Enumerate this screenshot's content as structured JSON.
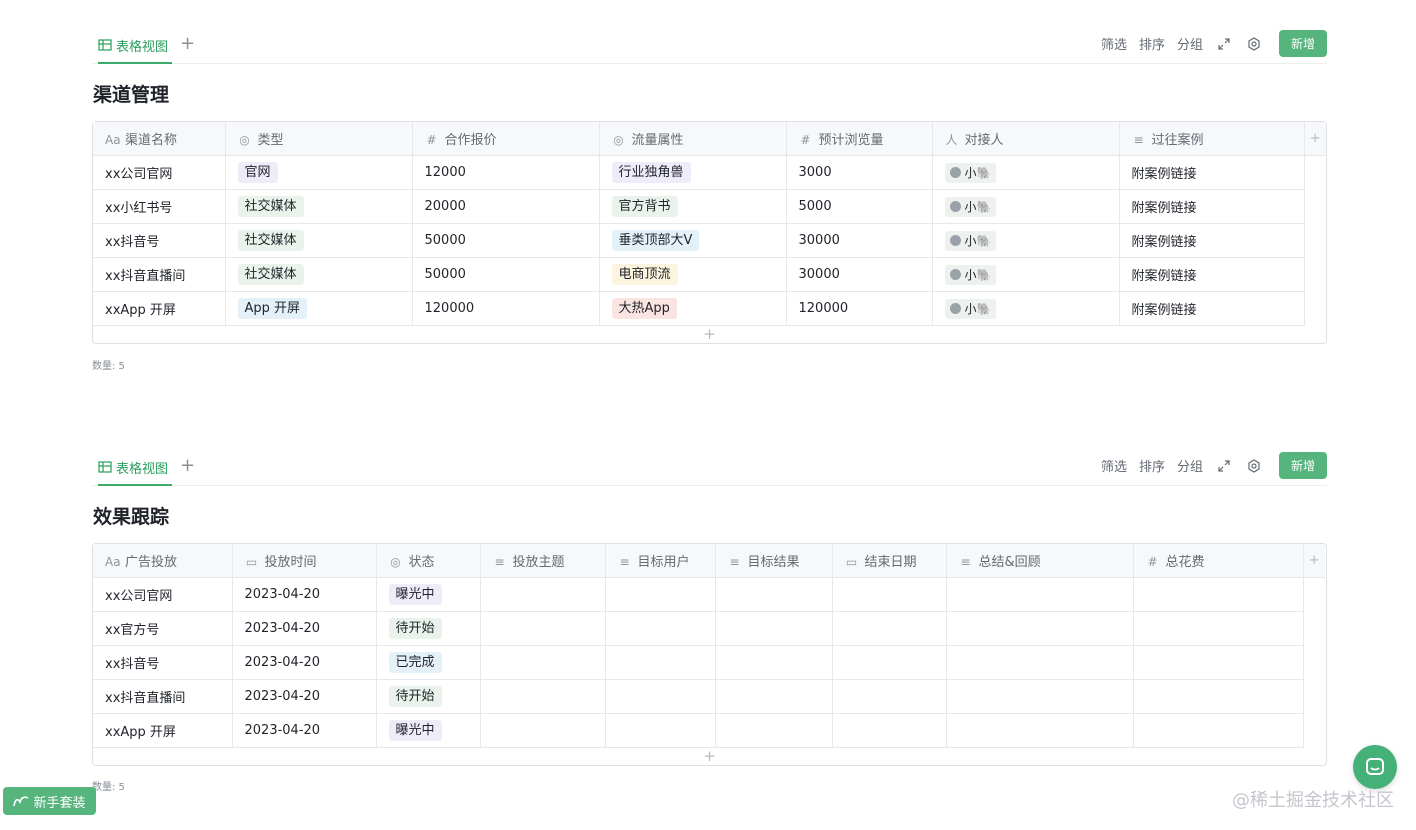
{
  "colors": {
    "accent": "#56b47d",
    "tab_active": "#2a9d5c"
  },
  "toolbar": {
    "tab_label": "表格视图",
    "add": "+",
    "filter": "筛选",
    "sort": "排序",
    "group": "分组",
    "new": "新增"
  },
  "table1": {
    "title": "渠道管理",
    "headers": [
      {
        "icon": "Aa",
        "label": "渠道名称"
      },
      {
        "icon": "◎",
        "label": "类型"
      },
      {
        "icon": "#",
        "label": "合作报价"
      },
      {
        "icon": "◎",
        "label": "流量属性"
      },
      {
        "icon": "#",
        "label": "预计浏览量"
      },
      {
        "icon": "人",
        "label": "对接人"
      },
      {
        "icon": "≡",
        "label": "过往案例"
      }
    ],
    "rows": [
      {
        "name": "xx公司官网",
        "type": "官网",
        "price": "12000",
        "traffic": "行业独角兽",
        "views": "3000",
        "contact": "小🐘",
        "case": "附案例链接"
      },
      {
        "name": "xx小红书号",
        "type": "社交媒体",
        "price": "20000",
        "traffic": "官方背书",
        "views": "5000",
        "contact": "小🐘",
        "case": "附案例链接"
      },
      {
        "name": "xx抖音号",
        "type": "社交媒体",
        "price": "50000",
        "traffic": "垂类顶部大V",
        "views": "30000",
        "contact": "小🐘",
        "case": "附案例链接"
      },
      {
        "name": "xx抖音直播间",
        "type": "社交媒体",
        "price": "50000",
        "traffic": "电商顶流",
        "views": "30000",
        "contact": "小🐘",
        "case": "附案例链接"
      },
      {
        "name": "xxApp 开屏",
        "type": "App 开屏",
        "price": "120000",
        "traffic": "大热App",
        "views": "120000",
        "contact": "小🐘",
        "case": "附案例链接"
      }
    ],
    "tag_colors": {
      "官网": "#eeecf9",
      "社交媒体": "#e9f3ec",
      "App 开屏": "#e5f1f9",
      "行业独角兽": "#eeecf9",
      "官方背书": "#e9f3ec",
      "垂类顶部大V": "#e5f1f9",
      "电商顶流": "#fbf4de",
      "大热App": "#fae4e2"
    },
    "count": "数量: 5"
  },
  "table2": {
    "title": "效果跟踪",
    "headers": [
      {
        "icon": "Aa",
        "label": "广告投放"
      },
      {
        "icon": "▭",
        "label": "投放时间"
      },
      {
        "icon": "◎",
        "label": "状态"
      },
      {
        "icon": "≡",
        "label": "投放主题"
      },
      {
        "icon": "≡",
        "label": "目标用户"
      },
      {
        "icon": "≡",
        "label": "目标结果"
      },
      {
        "icon": "▭",
        "label": "结束日期"
      },
      {
        "icon": "≡",
        "label": "总结&回顾"
      },
      {
        "icon": "#",
        "label": "总花费"
      }
    ],
    "rows": [
      {
        "name": "xx公司官网",
        "date": "2023-04-20",
        "status": "曝光中"
      },
      {
        "name": "xx官方号",
        "date": "2023-04-20",
        "status": "待开始"
      },
      {
        "name": "xx抖音号",
        "date": "2023-04-20",
        "status": "已完成"
      },
      {
        "name": "xx抖音直播间",
        "date": "2023-04-20",
        "status": "待开始"
      },
      {
        "name": "xxApp 开屏",
        "date": "2023-04-20",
        "status": "曝光中"
      }
    ],
    "status_colors": {
      "曝光中": "#eeecf9",
      "待开始": "#e9f3ec",
      "已完成": "#e5f1f9"
    },
    "count": "数量: 5"
  },
  "guide_button": "新手套装",
  "watermark": "@稀土掘金技术社区"
}
